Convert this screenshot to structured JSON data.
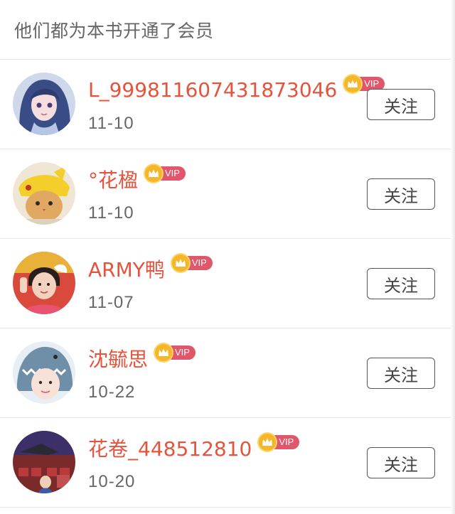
{
  "header": {
    "title": "他们都为本书开通了会员"
  },
  "vip_badge_text": "VIP",
  "colors": {
    "name": "#e5533d",
    "vip_tag": "#e0566b",
    "crown": "#f6b62a"
  },
  "members": [
    {
      "name": "L_999811607431873046",
      "date": "11-10",
      "follow_label": "关注",
      "avatar": "anime-girl-blue-hair"
    },
    {
      "name": "°花楹",
      "date": "11-10",
      "follow_label": "关注",
      "avatar": "cat-in-pikachu-hat"
    },
    {
      "name": "ARMY鸭",
      "date": "11-07",
      "follow_label": "关注",
      "avatar": "boy-waving-red-background"
    },
    {
      "name": "沈毓思",
      "date": "10-22",
      "follow_label": "关注",
      "avatar": "girl-in-shark-hood"
    },
    {
      "name": "花卷_448512810",
      "date": "10-20",
      "follow_label": "关注",
      "avatar": "performer-on-stage"
    }
  ]
}
